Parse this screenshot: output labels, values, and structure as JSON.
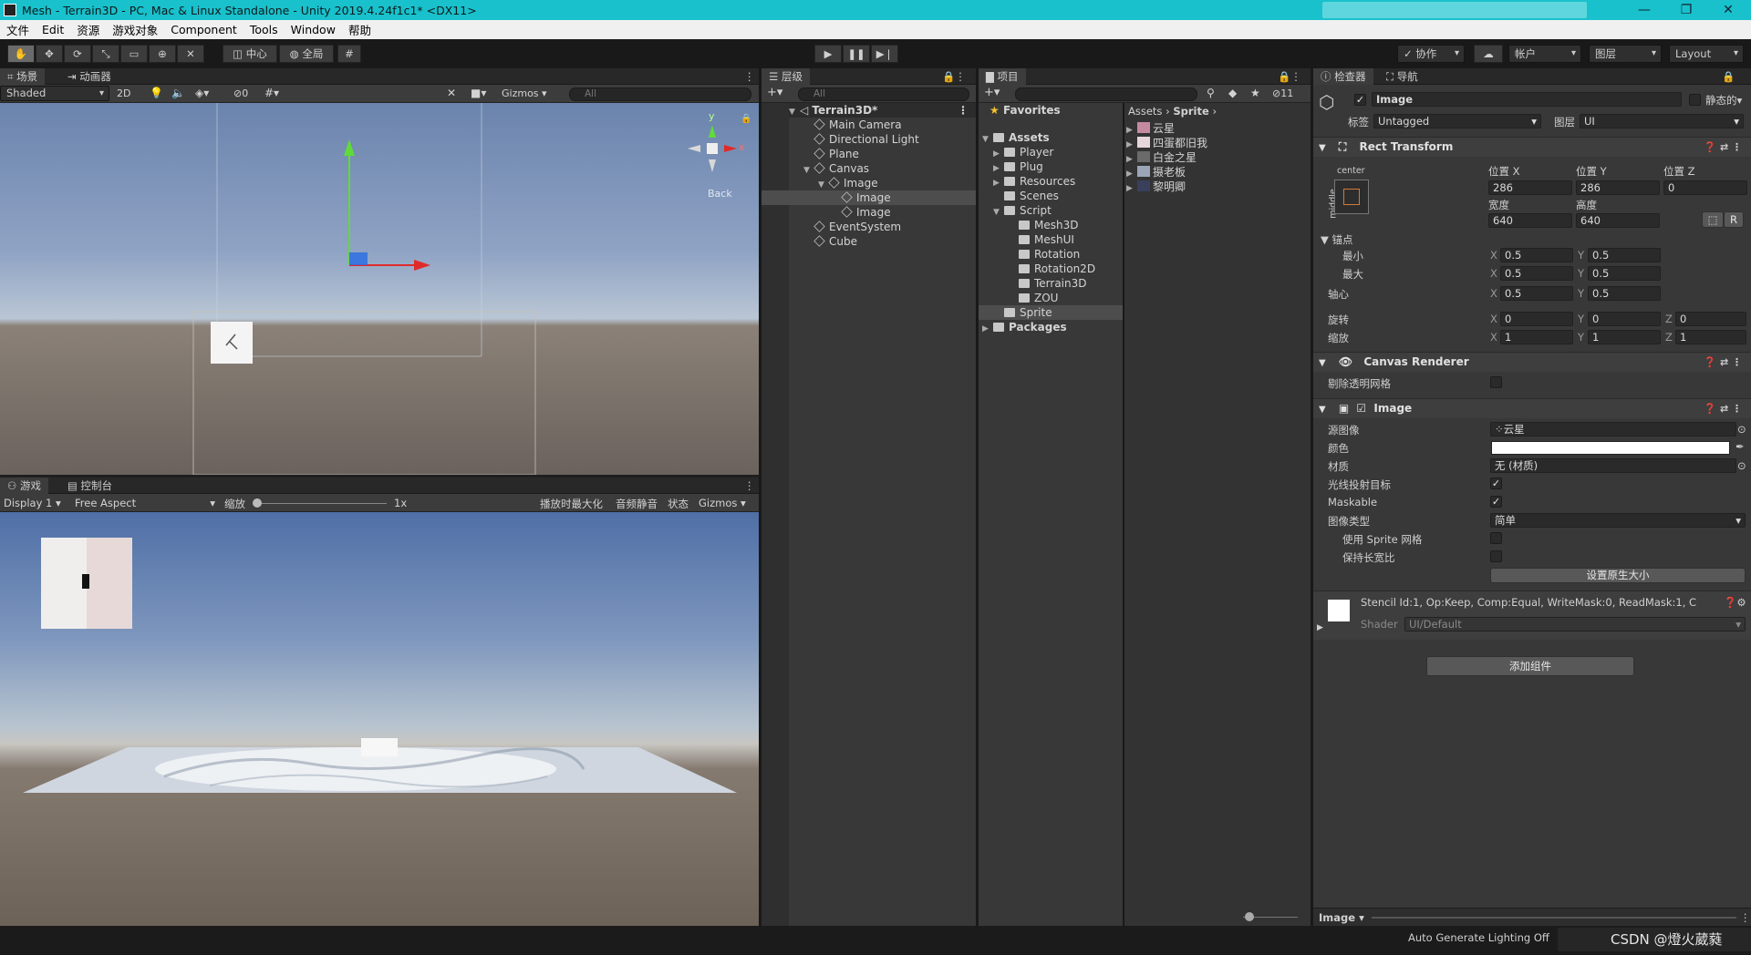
{
  "window": {
    "title": "Mesh - Terrain3D - PC, Mac & Linux Standalone - Unity 2019.4.24f1c1* <DX11>",
    "controls": [
      "—",
      "❐",
      "✕"
    ]
  },
  "menu": [
    "文件",
    "Edit",
    "资源",
    "游戏对象",
    "Component",
    "Tools",
    "Window",
    "帮助"
  ],
  "toolbar": {
    "pivot": "中心",
    "space": "全局",
    "collab": "协作",
    "account": "帐户",
    "layers": "图层",
    "layout": "Layout"
  },
  "scene": {
    "tabs": [
      "场景",
      "动画器"
    ],
    "shading": "Shaded",
    "mode2d": "2D",
    "hidden_count": "0",
    "gizmos": "Gizmos",
    "search_placeholder": "All",
    "back_label": "Back",
    "axis_y": "y",
    "axis_x": "x"
  },
  "game": {
    "tabs": [
      "游戏",
      "控制台"
    ],
    "display": "Display 1",
    "aspect": "Free Aspect",
    "scale_label": "缩放",
    "scale_value": "1x",
    "options": [
      "播放时最大化",
      "音频静音",
      "状态",
      "Gizmos"
    ]
  },
  "hierarchy": {
    "tab": "层级",
    "search_placeholder": "All",
    "root": "Terrain3D*",
    "items": [
      "Main Camera",
      "Directional Light",
      "Plane",
      "Canvas",
      "Image",
      "Image",
      "Image",
      "EventSystem",
      "Cube"
    ]
  },
  "project": {
    "tab": "项目",
    "hidden_count": "11",
    "favorites": "Favorites",
    "assets": "Assets",
    "tree": [
      "Player",
      "Plug",
      "Resources",
      "Scenes",
      "Script",
      "Mesh3D",
      "MeshUI",
      "Rotation",
      "Rotation2D",
      "Terrain3D",
      "ZOU",
      "Sprite"
    ],
    "packages": "Packages",
    "breadcrumb": [
      "Assets",
      "Sprite"
    ],
    "files": [
      "云星",
      "四蛋都旧我",
      "白金之星",
      "摄老板",
      "黎明卿"
    ]
  },
  "inspector": {
    "tabs": [
      "检查器",
      "导航"
    ],
    "object_name": "Image",
    "static": "静态的",
    "tag_label": "标签",
    "tag_value": "Untagged",
    "layer_label": "图层",
    "layer_value": "UI",
    "rect_transform": {
      "title": "Rect Transform",
      "anchor_preset_h": "center",
      "anchor_preset_v": "middle",
      "pos_x_label": "位置 X",
      "pos_y_label": "位置 Y",
      "pos_z_label": "位置 Z",
      "pos_x": "286",
      "pos_y": "286",
      "pos_z": "0",
      "width_label": "宽度",
      "height_label": "高度",
      "width": "640",
      "height": "640",
      "r_button": "R",
      "anchors_label": "锚点",
      "min_label": "最小",
      "max_label": "最大",
      "min_x": "0.5",
      "min_y": "0.5",
      "max_x": "0.5",
      "max_y": "0.5",
      "pivot_label": "轴心",
      "pivot_x": "0.5",
      "pivot_y": "0.5",
      "rotation_label": "旋转",
      "rot_x": "0",
      "rot_y": "0",
      "rot_z": "0",
      "scale_label": "缩放",
      "scale_x": "1",
      "scale_y": "1",
      "scale_z": "1",
      "x": "X",
      "y": "Y",
      "z": "Z"
    },
    "canvas_renderer": {
      "title": "Canvas Renderer",
      "cull_label": "剔除透明网格"
    },
    "image": {
      "title": "Image",
      "source_label": "源图像",
      "source_value": "云星",
      "color_label": "颜色",
      "material_label": "材质",
      "material_value": "无 (材质)",
      "raycast_label": "光线投射目标",
      "maskable_label": "Maskable",
      "type_label": "图像类型",
      "type_value": "简单",
      "sprite_mesh_label": "使用 Sprite 网格",
      "preserve_label": "保持长宽比",
      "native_size_button": "设置原生大小"
    },
    "material": {
      "stencil": "Stencil Id:1, Op:Keep, Comp:Equal, WriteMask:0, ReadMask:1, C",
      "shader_label": "Shader",
      "shader_value": "UI/Default"
    },
    "add_component": "添加组件",
    "footer_object": "Image"
  },
  "status": {
    "lighting": "Auto Generate Lighting Off",
    "watermark": "CSDN @燈火葳蕤"
  },
  "colors": {
    "titlebar": "#19c1cc",
    "panel": "#383838",
    "selection": "#4d4d4d",
    "gizmo_red": "#e02a2a",
    "gizmo_green": "#5fdb3a",
    "gizmo_blue": "#2d6ee0"
  }
}
